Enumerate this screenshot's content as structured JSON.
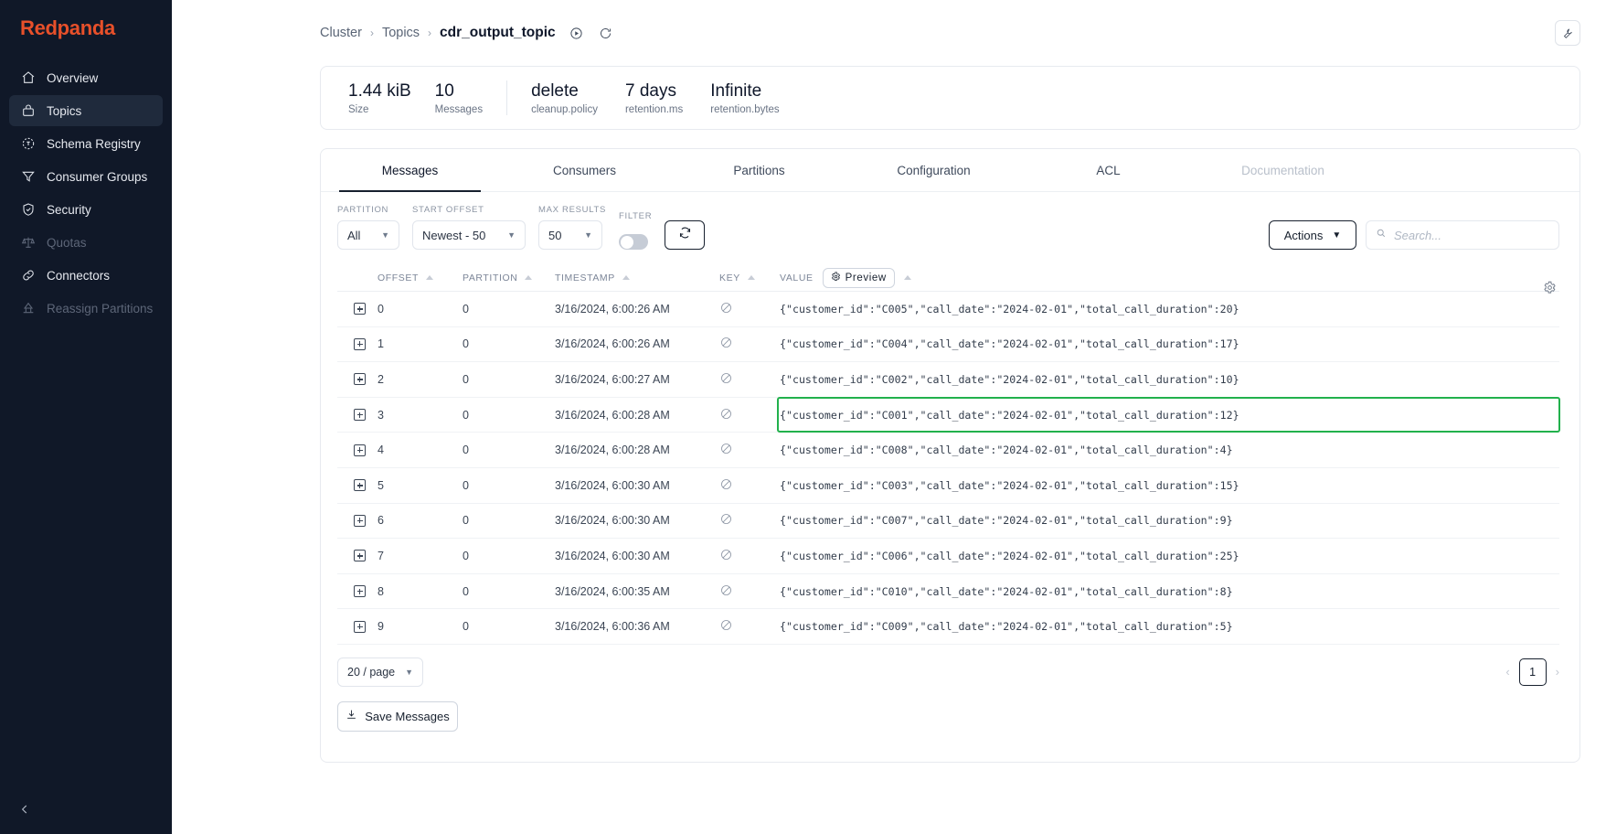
{
  "sidebar": {
    "brand": "Redpanda",
    "items": [
      {
        "label": "Overview",
        "icon": "home-icon",
        "state": "normal"
      },
      {
        "label": "Topics",
        "icon": "topics-icon",
        "state": "active"
      },
      {
        "label": "Schema Registry",
        "icon": "schema-registry-icon",
        "state": "normal"
      },
      {
        "label": "Consumer Groups",
        "icon": "funnel-icon",
        "state": "normal"
      },
      {
        "label": "Security",
        "icon": "shield-icon",
        "state": "normal"
      },
      {
        "label": "Quotas",
        "icon": "scales-icon",
        "state": "dim"
      },
      {
        "label": "Connectors",
        "icon": "link-icon",
        "state": "normal"
      },
      {
        "label": "Reassign Partitions",
        "icon": "reassign-icon",
        "state": "dim"
      }
    ],
    "collapse_icon": "chevron-left-icon"
  },
  "header": {
    "breadcrumb": [
      "Cluster",
      "Topics"
    ],
    "current": "cdr_output_topic",
    "separator": "›",
    "play_icon": "play-circle-icon",
    "refresh_icon": "refresh-icon",
    "top_right_icon": "tools-icon"
  },
  "stats": [
    {
      "value": "1.44 kiB",
      "label": "Size"
    },
    {
      "value": "10",
      "label": "Messages"
    },
    {
      "value": "delete",
      "label": "cleanup.policy"
    },
    {
      "value": "7 days",
      "label": "retention.ms"
    },
    {
      "value": "Infinite",
      "label": "retention.bytes"
    }
  ],
  "tabs": [
    {
      "label": "Messages",
      "state": "active"
    },
    {
      "label": "Consumers",
      "state": "normal"
    },
    {
      "label": "Partitions",
      "state": "normal"
    },
    {
      "label": "Configuration",
      "state": "normal"
    },
    {
      "label": "ACL",
      "state": "normal"
    },
    {
      "label": "Documentation",
      "state": "disabled"
    }
  ],
  "controls": {
    "partition": {
      "label": "PARTITION",
      "value": "All"
    },
    "start_offset": {
      "label": "START OFFSET",
      "value": "Newest - 50"
    },
    "max_results": {
      "label": "MAX RESULTS",
      "value": "50"
    },
    "filter": {
      "label": "FILTER",
      "enabled": false
    },
    "refresh_icon": "refresh-icon",
    "actions_label": "Actions",
    "actions_caret": "chevron-down-icon",
    "search": {
      "placeholder": "Search...",
      "value": "",
      "icon": "search-icon"
    }
  },
  "table": {
    "columns": [
      {
        "key": "expand",
        "label": ""
      },
      {
        "key": "offset",
        "label": "OFFSET",
        "sortable": true
      },
      {
        "key": "partition",
        "label": "PARTITION",
        "sortable": true
      },
      {
        "key": "timestamp",
        "label": "TIMESTAMP",
        "sortable": true
      },
      {
        "key": "key",
        "label": "KEY",
        "sortable": true
      },
      {
        "key": "value",
        "label": "VALUE",
        "sortable": true
      }
    ],
    "preview_label": "Preview",
    "preview_icon": "gear-icon",
    "settings_icon": "gear-icon",
    "key_icon": "null-circle-icon",
    "expand_icon": "expand-plus-icon",
    "highlight_color": "#22b14c",
    "rows": [
      {
        "offset": "0",
        "partition": "0",
        "timestamp": "3/16/2024, 6:00:26 AM",
        "key": "",
        "value": "{\"customer_id\":\"C005\",\"call_date\":\"2024-02-01\",\"total_call_duration\":20}",
        "highlighted": false
      },
      {
        "offset": "1",
        "partition": "0",
        "timestamp": "3/16/2024, 6:00:26 AM",
        "key": "",
        "value": "{\"customer_id\":\"C004\",\"call_date\":\"2024-02-01\",\"total_call_duration\":17}",
        "highlighted": false
      },
      {
        "offset": "2",
        "partition": "0",
        "timestamp": "3/16/2024, 6:00:27 AM",
        "key": "",
        "value": "{\"customer_id\":\"C002\",\"call_date\":\"2024-02-01\",\"total_call_duration\":10}",
        "highlighted": false
      },
      {
        "offset": "3",
        "partition": "0",
        "timestamp": "3/16/2024, 6:00:28 AM",
        "key": "",
        "value": "{\"customer_id\":\"C001\",\"call_date\":\"2024-02-01\",\"total_call_duration\":12}",
        "highlighted": true
      },
      {
        "offset": "4",
        "partition": "0",
        "timestamp": "3/16/2024, 6:00:28 AM",
        "key": "",
        "value": "{\"customer_id\":\"C008\",\"call_date\":\"2024-02-01\",\"total_call_duration\":4}",
        "highlighted": false
      },
      {
        "offset": "5",
        "partition": "0",
        "timestamp": "3/16/2024, 6:00:30 AM",
        "key": "",
        "value": "{\"customer_id\":\"C003\",\"call_date\":\"2024-02-01\",\"total_call_duration\":15}",
        "highlighted": false
      },
      {
        "offset": "6",
        "partition": "0",
        "timestamp": "3/16/2024, 6:00:30 AM",
        "key": "",
        "value": "{\"customer_id\":\"C007\",\"call_date\":\"2024-02-01\",\"total_call_duration\":9}",
        "highlighted": false
      },
      {
        "offset": "7",
        "partition": "0",
        "timestamp": "3/16/2024, 6:00:30 AM",
        "key": "",
        "value": "{\"customer_id\":\"C006\",\"call_date\":\"2024-02-01\",\"total_call_duration\":25}",
        "highlighted": false
      },
      {
        "offset": "8",
        "partition": "0",
        "timestamp": "3/16/2024, 6:00:35 AM",
        "key": "",
        "value": "{\"customer_id\":\"C010\",\"call_date\":\"2024-02-01\",\"total_call_duration\":8}",
        "highlighted": false
      },
      {
        "offset": "9",
        "partition": "0",
        "timestamp": "3/16/2024, 6:00:36 AM",
        "key": "",
        "value": "{\"customer_id\":\"C009\",\"call_date\":\"2024-02-01\",\"total_call_duration\":5}",
        "highlighted": false
      }
    ]
  },
  "footer": {
    "page_size": "20 / page",
    "page_size_caret": "chevron-down-icon",
    "prev_arrow": "‹",
    "next_arrow": "›",
    "current_page": "1",
    "save_label": "Save Messages",
    "save_icon": "download-icon"
  }
}
